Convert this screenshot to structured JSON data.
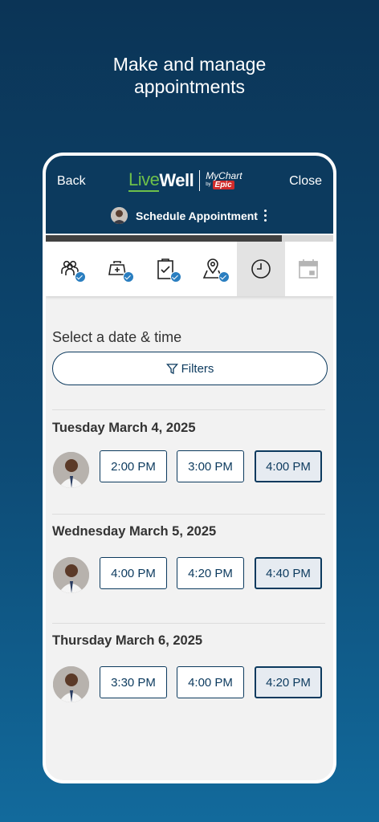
{
  "headline": {
    "line1": "Make and manage",
    "line2": "appointments"
  },
  "appbar": {
    "back_label": "Back",
    "close_label": "Close",
    "logo": {
      "live": "Live",
      "well": "Well",
      "mychart": "MyChart",
      "by": "by",
      "epic": "Epic"
    },
    "title": "Schedule Appointment"
  },
  "progress": {
    "fraction": 0.82
  },
  "steps": [
    {
      "icon": "people-icon",
      "completed": true
    },
    {
      "icon": "medical-bag-icon",
      "completed": true
    },
    {
      "icon": "clipboard-check-icon",
      "completed": true
    },
    {
      "icon": "map-pin-icon",
      "completed": true
    },
    {
      "icon": "clock-icon",
      "completed": false,
      "active": true
    },
    {
      "icon": "calendar-icon",
      "completed": false
    }
  ],
  "content": {
    "prompt": "Select a date & time",
    "filters_label": "Filters"
  },
  "days": [
    {
      "title": "Tuesday March 4, 2025",
      "slots": [
        "2:00 PM",
        "3:00 PM",
        "4:00 PM"
      ],
      "selected_index": 2
    },
    {
      "title": "Wednesday March 5, 2025",
      "slots": [
        "4:00 PM",
        "4:20 PM",
        "4:40 PM"
      ],
      "selected_index": 2
    },
    {
      "title": "Thursday March 6, 2025",
      "slots": [
        "3:30 PM",
        "4:00 PM",
        "4:20 PM"
      ],
      "selected_index": 2
    }
  ],
  "colors": {
    "brand_navy": "#0c3a5e",
    "livewell_green": "#6ec04a",
    "epic_red": "#d02b2b",
    "check_blue": "#2a7ec0"
  }
}
